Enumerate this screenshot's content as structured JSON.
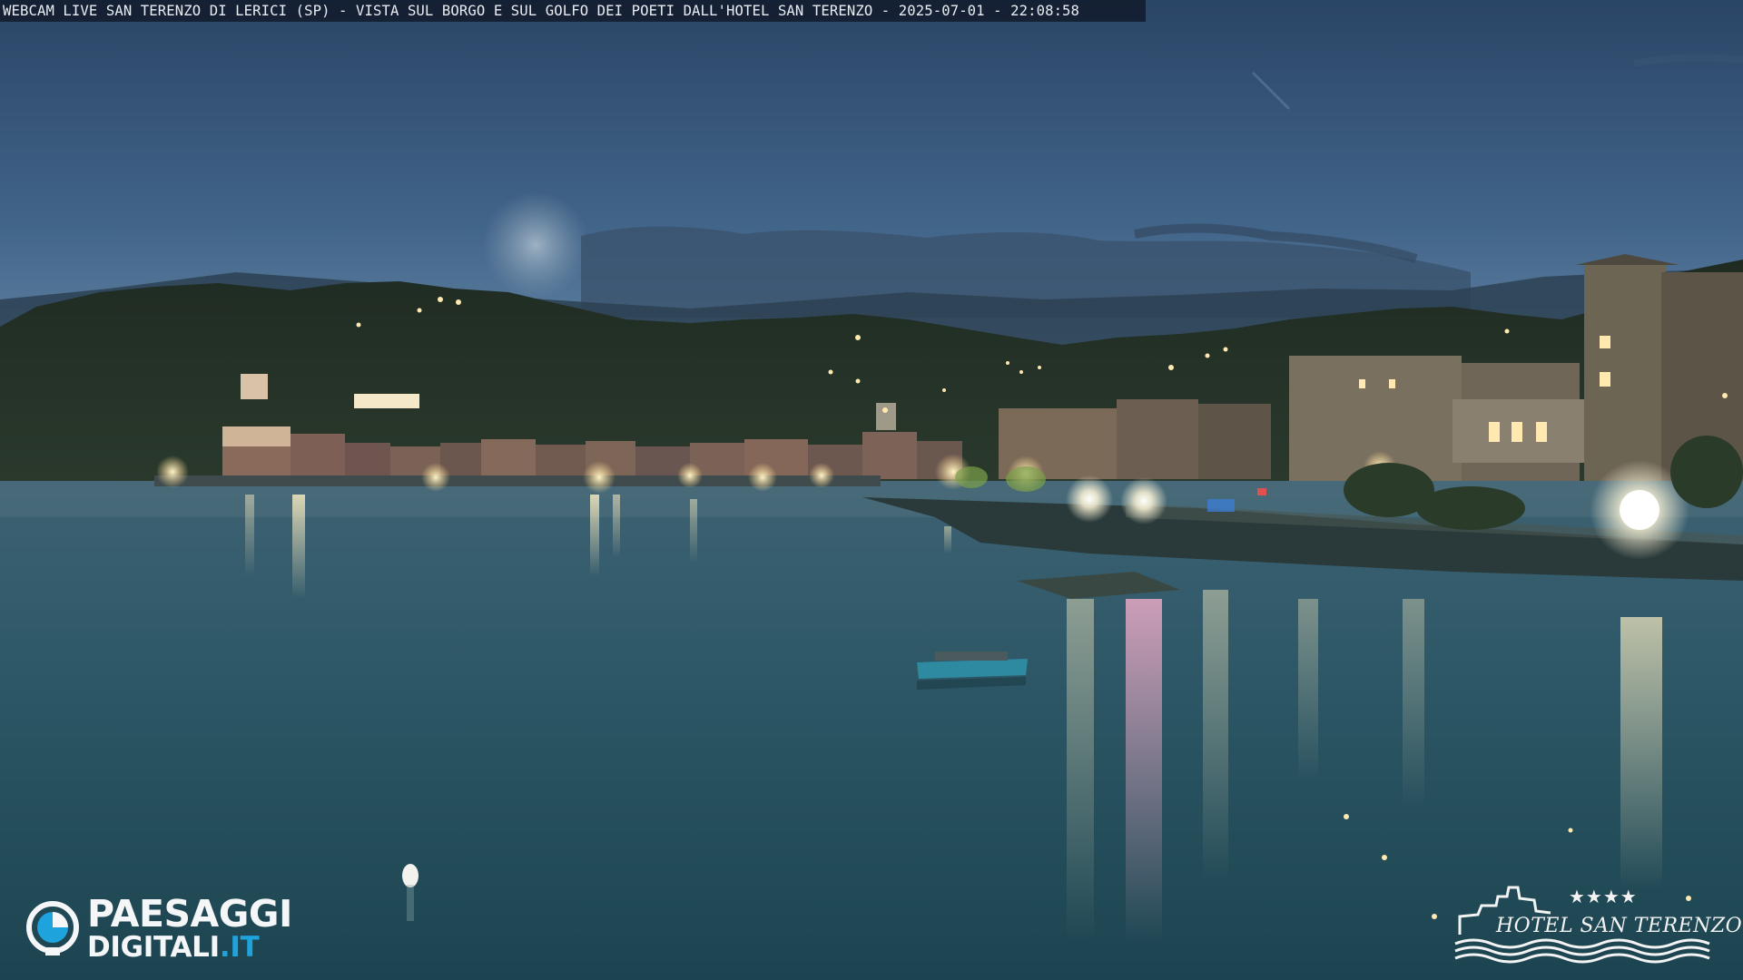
{
  "overlay": {
    "caption": "WEBCAM LIVE SAN TERENZO DI LERICI (SP) - VISTA SUL BORGO E SUL GOLFO DEI POETI DALL'HOTEL SAN TERENZO - 2025-07-01 - 22:08:58"
  },
  "branding": {
    "paesaggi_word": "PAESAGGI",
    "digitali_word": "DIGITALI",
    "digitali_tld": ".IT",
    "hotel_stars": "★★★★",
    "hotel_name": "HOTEL SAN TERENZO",
    "logo_icon": "paesaggi-digitali-logo-icon",
    "hotel_icon": "castle-waves-icon"
  },
  "colors": {
    "sky_top": "#2c4869",
    "sky_horizon": "#6a8aa8",
    "water": "#1f4a57",
    "lights": "#ffe9b0",
    "brand_accent": "#1ea3dc"
  }
}
